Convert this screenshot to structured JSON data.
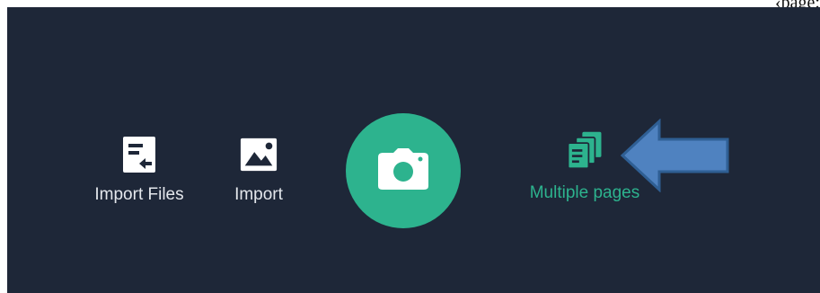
{
  "corner_text": "‹page:",
  "toolbar": {
    "import_files": {
      "label": "Import Files",
      "icon": "import-file-icon"
    },
    "import": {
      "label": "Import",
      "icon": "image-icon"
    },
    "shutter": {
      "icon": "camera-icon"
    },
    "multiple_pages": {
      "label": "Multiple pages",
      "icon": "multiple-pages-icon",
      "state": "selected"
    }
  },
  "annotation": {
    "icon": "left-arrow-pointer"
  },
  "colors": {
    "toolbar_bg": "#1e2738",
    "accent": "#2db38e",
    "label": "#e4e7ec",
    "arrow_fill": "#4f82c0",
    "arrow_stroke": "#2f5f94"
  }
}
